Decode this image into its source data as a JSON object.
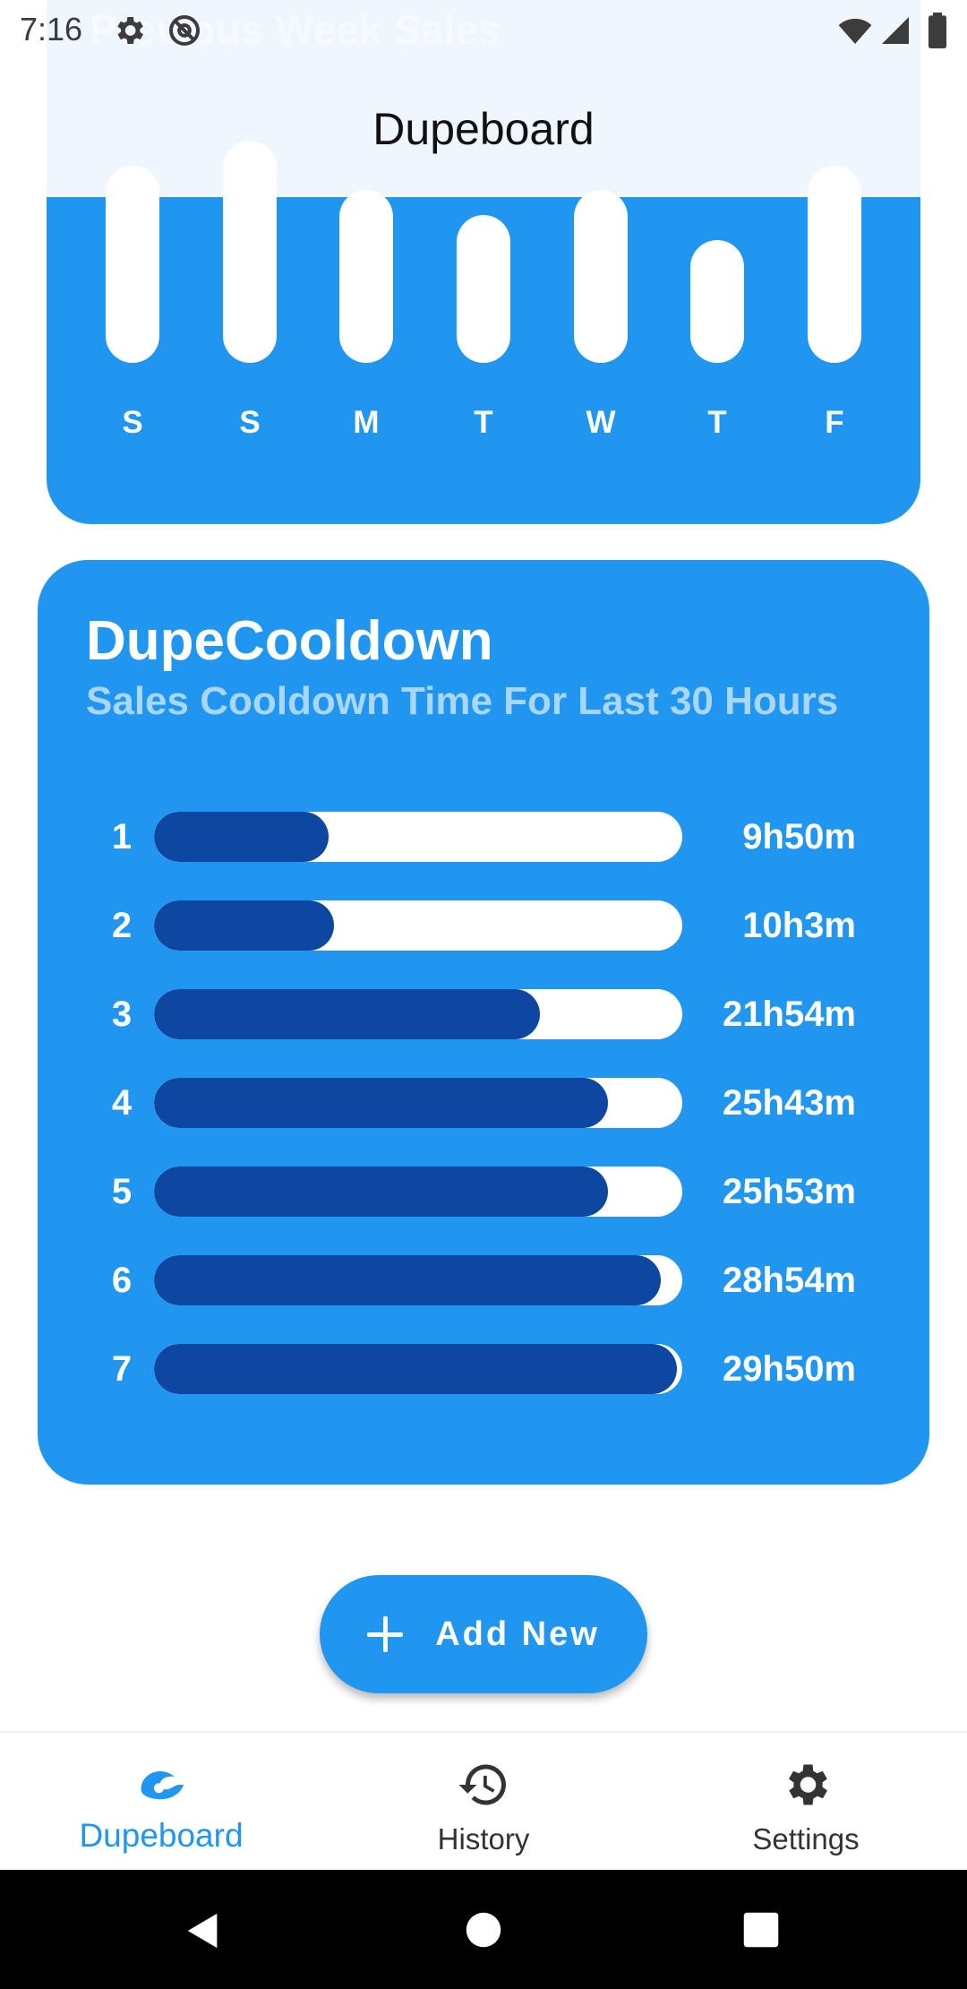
{
  "status_bar": {
    "time": "7:16"
  },
  "header": {
    "title": "Dupeboard",
    "ghost_subtitle": "Previous Week Sales"
  },
  "week_chart": {
    "days": [
      "S",
      "S",
      "M",
      "T",
      "W",
      "T",
      "F"
    ],
    "levels": [
      0.83,
      1.0,
      0.67,
      0.5,
      0.67,
      0.33,
      0.83
    ]
  },
  "cooldown": {
    "title": "DupeCooldown",
    "subtitle": "Sales Cooldown Time For Last 30 Hours",
    "rows": [
      {
        "rank": "1",
        "value": "9h50m",
        "fraction": 0.33
      },
      {
        "rank": "2",
        "value": "10h3m",
        "fraction": 0.34
      },
      {
        "rank": "3",
        "value": "21h54m",
        "fraction": 0.73
      },
      {
        "rank": "4",
        "value": "25h43m",
        "fraction": 0.86
      },
      {
        "rank": "5",
        "value": "25h53m",
        "fraction": 0.86
      },
      {
        "rank": "6",
        "value": "28h54m",
        "fraction": 0.96
      },
      {
        "rank": "7",
        "value": "29h50m",
        "fraction": 0.99
      }
    ]
  },
  "add_button": {
    "label": "Add New",
    "icon": "plus-icon"
  },
  "bottom_nav": {
    "items": [
      {
        "label": "Dupeboard",
        "icon": "wave-icon",
        "active": true
      },
      {
        "label": "History",
        "icon": "history-icon",
        "active": false
      },
      {
        "label": "Settings",
        "icon": "gear-icon",
        "active": false
      }
    ]
  },
  "colors": {
    "primary": "#2196f0",
    "dark_fill": "#0d47a1",
    "subtitle": "#a9d7fb",
    "header_bg": "#eff6fe"
  }
}
